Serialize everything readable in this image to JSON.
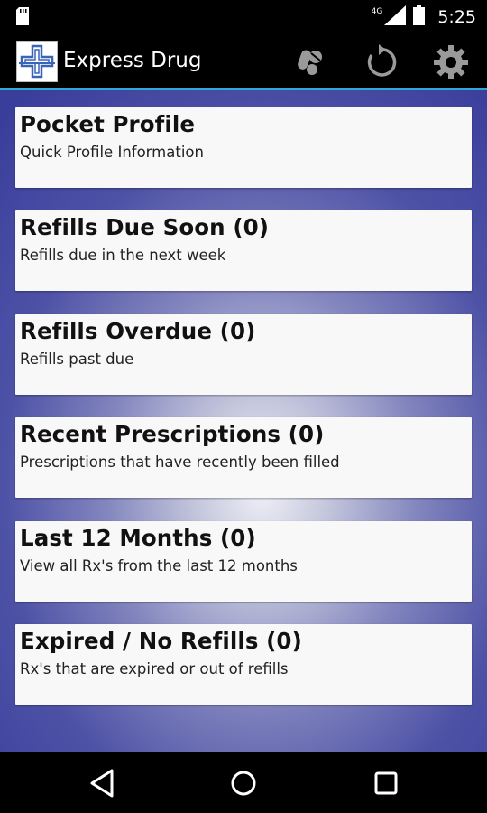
{
  "status_bar": {
    "time": "5:25",
    "network": "4G",
    "icons": [
      "sd-card-icon",
      "signal-icon",
      "battery-icon"
    ]
  },
  "action_bar": {
    "title": "Express Drug",
    "accent_color": "#33a7d6",
    "actions": [
      "pill-icon",
      "refresh-icon",
      "settings-icon"
    ]
  },
  "cards": [
    {
      "title": "Pocket Profile",
      "subtitle": "Quick Profile Information"
    },
    {
      "title": "Refills Due Soon (0)",
      "subtitle": "Refills due in the next week"
    },
    {
      "title": "Refills Overdue (0)",
      "subtitle": "Refills past due"
    },
    {
      "title": "Recent Prescriptions (0)",
      "subtitle": "Prescriptions that have recently been filled"
    },
    {
      "title": "Last 12 Months (0)",
      "subtitle": "View all Rx's from the last 12 months"
    },
    {
      "title": "Expired / No Refills (0)",
      "subtitle": "Rx's that are expired or out of refills"
    }
  ],
  "nav_bar": {
    "buttons": [
      "back-icon",
      "home-icon",
      "recents-icon"
    ]
  }
}
